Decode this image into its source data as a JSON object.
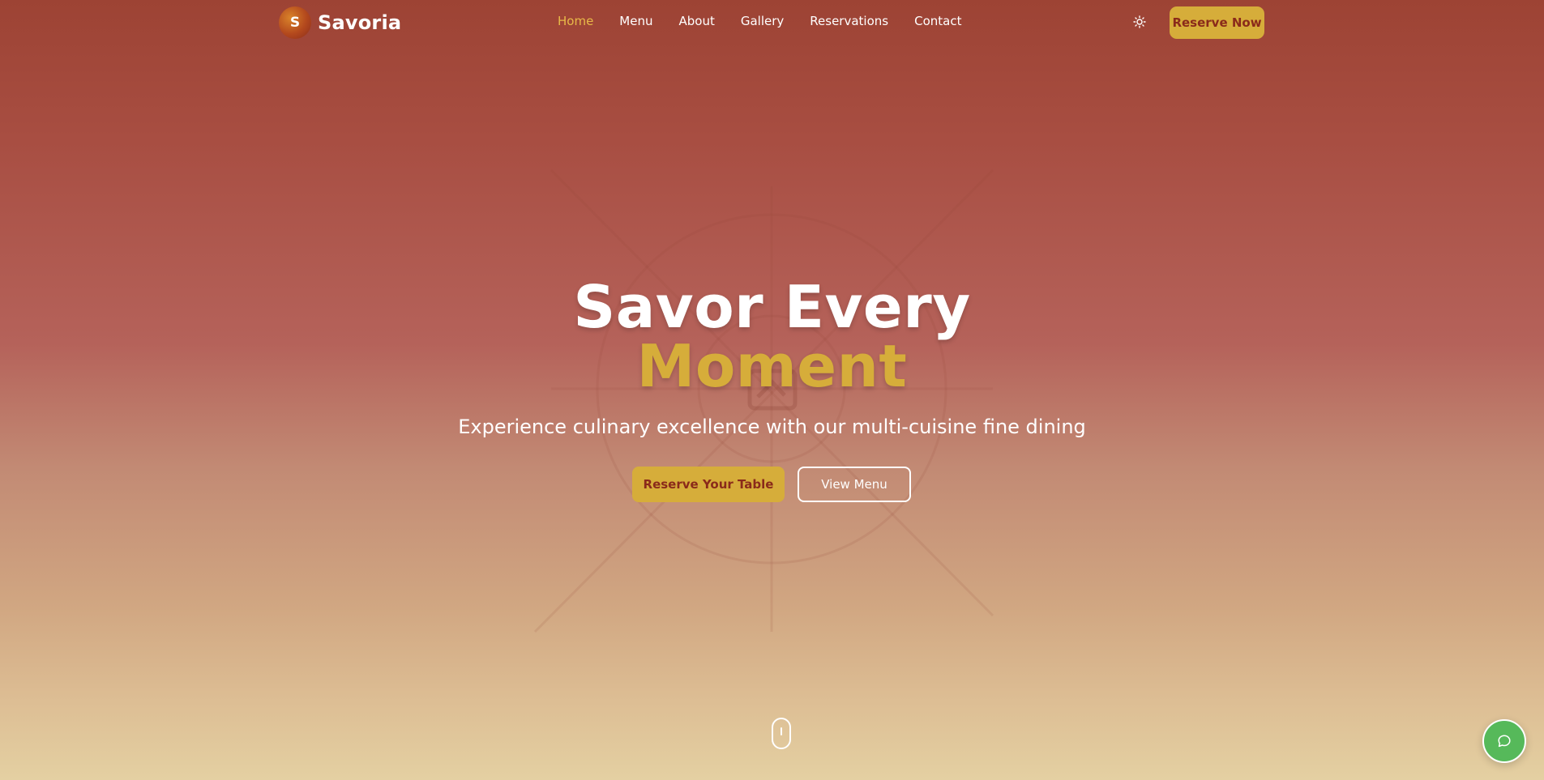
{
  "brand": {
    "logo_letter": "S",
    "name": "Savoria"
  },
  "nav": {
    "items": [
      {
        "label": "Home",
        "active": true
      },
      {
        "label": "Menu"
      },
      {
        "label": "About"
      },
      {
        "label": "Gallery"
      },
      {
        "label": "Reservations"
      },
      {
        "label": "Contact"
      }
    ],
    "theme_icon": "sun-icon",
    "reserve_label": "Reserve Now"
  },
  "hero": {
    "title_line1": "Savor Every",
    "title_line2": "Moment",
    "subtitle": "Experience culinary excellence with our multi-cuisine fine dining",
    "primary_button": "Reserve Your Table",
    "secondary_button": "View Menu",
    "background_icon": "image-placeholder-icon"
  },
  "scroll_indicator": "mouse-scroll-icon",
  "chat_icon": "chat-bubble-icon",
  "colors": {
    "accent_gold": "#d6ad3a",
    "nav_active": "#e8b948",
    "dark_red_text": "#8a2a1a",
    "chat_green": "#56b95a"
  }
}
